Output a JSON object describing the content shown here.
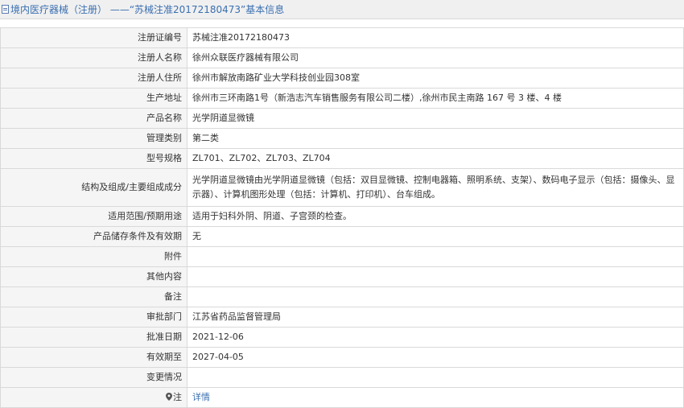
{
  "header": {
    "title": "境内医疗器械（注册） ——“苏械注准20172180473”基本信息"
  },
  "rows": [
    {
      "label": "注册证编号",
      "value": "苏械注准20172180473"
    },
    {
      "label": "注册人名称",
      "value": "徐州众联医疗器械有限公司"
    },
    {
      "label": "注册人住所",
      "value": "徐州市解放南路矿业大学科技创业园308室"
    },
    {
      "label": "生产地址",
      "value": "徐州市三环南路1号（新浩志汽车销售服务有限公司二楼）,徐州市民主南路 167 号 3 楼、4 楼"
    },
    {
      "label": "产品名称",
      "value": "光学阴道显微镜"
    },
    {
      "label": "管理类别",
      "value": "第二类"
    },
    {
      "label": "型号规格",
      "value": "ZL701、ZL702、ZL703、ZL704"
    },
    {
      "label": "结构及组成/主要组成成分",
      "value": "光学阴道显微镜由光学阴道显微镜（包括：双目显微镜、控制电器箱、照明系统、支架）、数码电子显示（包括：摄像头、显示器）、计算机图形处理（包括：计算机、打印机）、台车组成。"
    },
    {
      "label": "适用范围/预期用途",
      "value": "适用于妇科外阴、阴道、子宫颈的检查。"
    },
    {
      "label": "产品储存条件及有效期",
      "value": "无"
    },
    {
      "label": "附件",
      "value": ""
    },
    {
      "label": "其他内容",
      "value": ""
    },
    {
      "label": "备注",
      "value": ""
    },
    {
      "label": "审批部门",
      "value": "江苏省药品监督管理局"
    },
    {
      "label": "批准日期",
      "value": "2021-12-06"
    },
    {
      "label": "有效期至",
      "value": "2027-04-05"
    },
    {
      "label": "变更情况",
      "value": ""
    }
  ],
  "note": {
    "label": "注",
    "link_text": "详情",
    "icon": "location-pin-icon"
  },
  "colors": {
    "title_blue": "#3a6fb0",
    "label_bg": "#f5f5f5",
    "border": "#d9d9d9"
  }
}
